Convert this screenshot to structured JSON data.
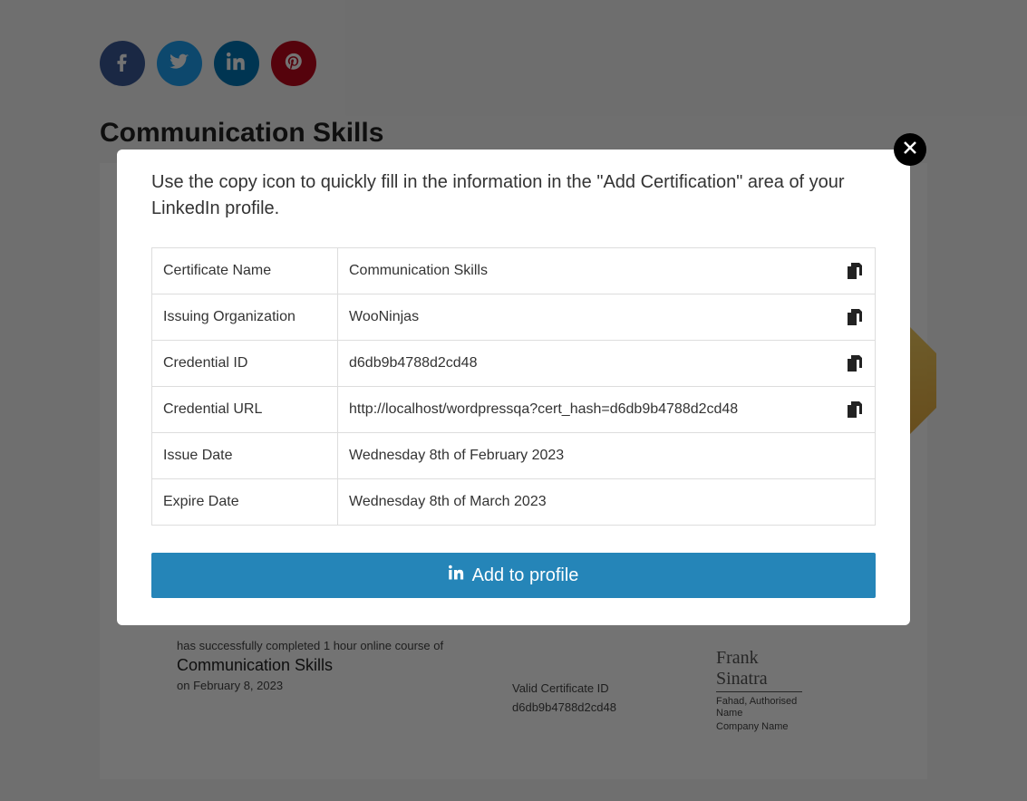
{
  "page": {
    "title": "Communication Skills"
  },
  "social": {
    "facebook": "facebook",
    "twitter": "twitter",
    "linkedin": "linkedin",
    "pinterest": "pinterest"
  },
  "modal": {
    "intro": "Use the copy icon to quickly fill in the information in the \"Add Certification\" area of your LinkedIn profile.",
    "rows": {
      "cert_name": {
        "label": "Certificate Name",
        "value": "Communication Skills",
        "copy": true
      },
      "issuer": {
        "label": "Issuing Organization",
        "value": "WooNinjas",
        "copy": true
      },
      "cred_id": {
        "label": "Credential ID",
        "value": "d6db9b4788d2cd48",
        "copy": true
      },
      "cred_url": {
        "label": "Credential URL",
        "value": "http://localhost/wordpressqa?cert_hash=d6db9b4788d2cd48",
        "copy": true
      },
      "issue_date": {
        "label": "Issue Date",
        "value": "Wednesday 8th of February 2023",
        "copy": false
      },
      "expire_date": {
        "label": "Expire Date",
        "value": "Wednesday 8th of March 2023",
        "copy": false
      }
    },
    "add_button": "Add to profile"
  },
  "certificate_bg": {
    "completion_line": "has successfully completed 1 hour online course of",
    "course_name": "Communication Skills",
    "on_date": "on February 8, 2023",
    "valid_id_label": "Valid Certificate ID",
    "valid_id_value": "d6db9b4788d2cd48",
    "signature": "Frank Sinatra",
    "auth_name": "Fahad, Authorised Name",
    "company": "Company Name"
  },
  "colors": {
    "accent": "#2585b8"
  }
}
